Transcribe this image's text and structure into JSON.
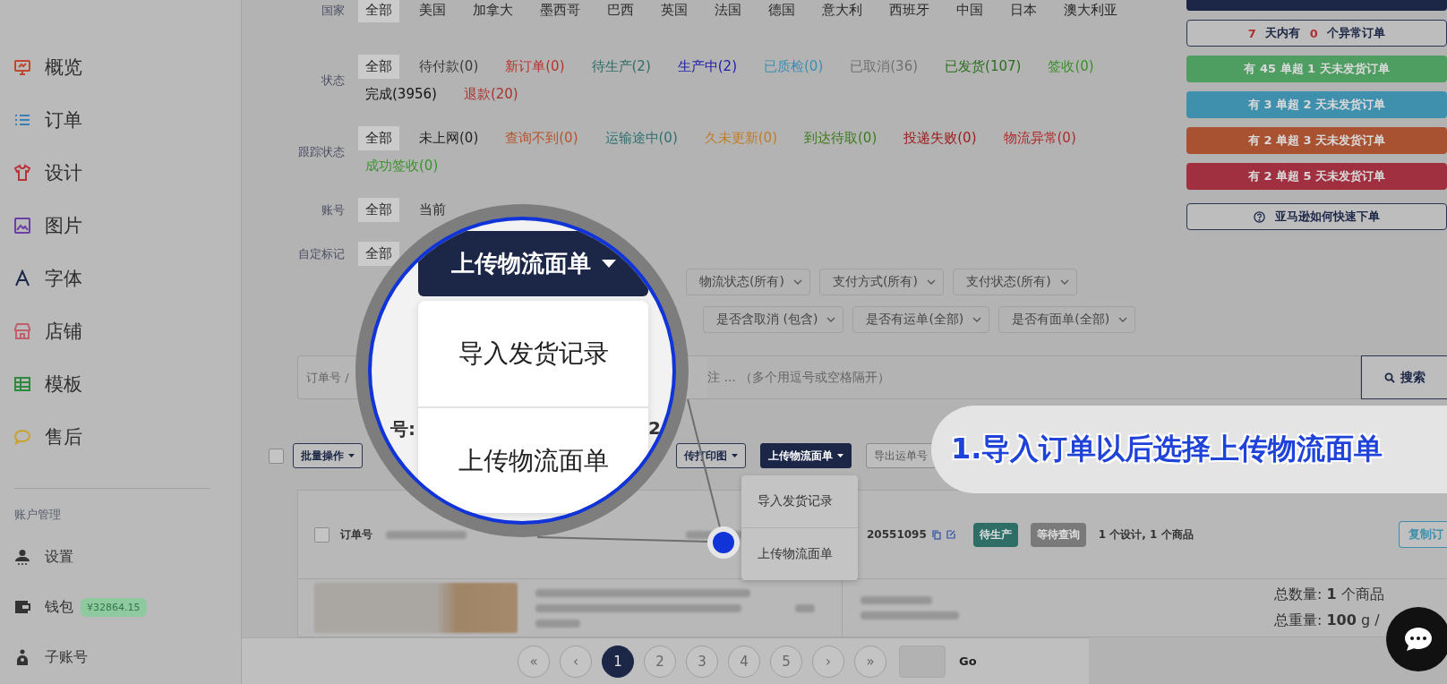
{
  "sidebar": {
    "nav": [
      {
        "label": "概览",
        "color": "#c2452d"
      },
      {
        "label": "订单",
        "color": "#3a7fb8"
      },
      {
        "label": "设计",
        "color": "#b8343a"
      },
      {
        "label": "图片",
        "color": "#6a3fa8"
      },
      {
        "label": "字体",
        "color": "#1c2747"
      },
      {
        "label": "店铺",
        "color": "#c0606a"
      },
      {
        "label": "模板",
        "color": "#2f8a3e"
      },
      {
        "label": "售后",
        "color": "#c9a22a"
      }
    ],
    "section_title": "账户管理",
    "account": [
      {
        "label": "设置"
      },
      {
        "label": "钱包",
        "badge": "¥32864.15"
      },
      {
        "label": "子账号"
      }
    ]
  },
  "filters": [
    {
      "label": "国家",
      "options": [
        {
          "text": "全部",
          "selected": true
        },
        {
          "text": "美国",
          "selected": false
        },
        {
          "text": "加拿大",
          "selected": false
        },
        {
          "text": "墨西哥",
          "selected": false
        },
        {
          "text": "巴西",
          "selected": false
        },
        {
          "text": "英国",
          "selected": false
        },
        {
          "text": "法国",
          "selected": false
        },
        {
          "text": "德国",
          "selected": false
        },
        {
          "text": "意大利",
          "selected": false
        },
        {
          "text": "西班牙",
          "selected": false
        },
        {
          "text": "中国",
          "selected": false
        },
        {
          "text": "日本",
          "selected": false
        },
        {
          "text": "澳大利亚",
          "selected": false
        }
      ]
    },
    {
      "label": "状态",
      "options": [
        {
          "text": "全部",
          "selected": true,
          "color": "#1e1e1e"
        },
        {
          "text": "待付款(0)",
          "selected": false,
          "color": "#3a3a3a"
        },
        {
          "text": "新订单(0)",
          "selected": false,
          "color": "#b8332c"
        },
        {
          "text": "待生产(2)",
          "selected": false,
          "color": "#2e6e66"
        },
        {
          "text": "生产中(2)",
          "selected": false,
          "color": "#1a1aa8"
        },
        {
          "text": "已质检(0)",
          "selected": false,
          "color": "#3b8fb0"
        },
        {
          "text": "已取消(36)",
          "selected": false,
          "color": "#707070"
        },
        {
          "text": "已发货(107)",
          "selected": false,
          "color": "#2b6e1e"
        },
        {
          "text": "签收(0)",
          "selected": false,
          "color": "#3a8f28"
        },
        {
          "text": "完成(3956)",
          "selected": false,
          "color": "#111111"
        },
        {
          "text": "退款(20)",
          "selected": false,
          "color": "#a8322c"
        }
      ]
    },
    {
      "label": "跟踪状态",
      "options": [
        {
          "text": "全部",
          "selected": true,
          "color": "#1e1e1e"
        },
        {
          "text": "未上网(0)",
          "selected": false,
          "color": "#222222"
        },
        {
          "text": "查询不到(0)",
          "selected": false,
          "color": "#b5532a"
        },
        {
          "text": "运输途中(0)",
          "selected": false,
          "color": "#2e7070"
        },
        {
          "text": "久未更新(0)",
          "selected": false,
          "color": "#c07d2a"
        },
        {
          "text": "到达待取(0)",
          "selected": false,
          "color": "#3d7a1e"
        },
        {
          "text": "投递失败(0)",
          "selected": false,
          "color": "#9c1c1c"
        },
        {
          "text": "物流异常(0)",
          "selected": false,
          "color": "#b02a2a"
        },
        {
          "text": "成功签收(0)",
          "selected": false,
          "color": "#3a9428"
        }
      ]
    },
    {
      "label": "账号",
      "options": [
        {
          "text": "全部",
          "selected": true
        },
        {
          "text": "当前",
          "selected": false
        }
      ]
    },
    {
      "label": "自定标记",
      "options": [
        {
          "text": "全部",
          "selected": true
        }
      ]
    }
  ],
  "alerts": [
    {
      "kind": "outline",
      "parts": [
        {
          "text": "7",
          "highlight": true
        },
        {
          "text": " 天内有 ",
          "highlight": false
        },
        {
          "text": "0",
          "highlight": true
        },
        {
          "text": " 个异常订单",
          "highlight": false
        }
      ]
    },
    {
      "kind": "filled",
      "text": "有 45 单超 1 天未发货订单",
      "color": "#4e9e62"
    },
    {
      "kind": "filled",
      "text": "有 3 单超 2 天未发货订单",
      "color": "#3f90ad"
    },
    {
      "kind": "filled",
      "text": "有 2 单超 3 天未发货订单",
      "color": "#a85232"
    },
    {
      "kind": "filled",
      "text": "有 2 单超 5 天未发货订单",
      "color": "#a03040"
    },
    {
      "kind": "help",
      "text": "亚马逊如何快速下单"
    }
  ],
  "filter_selects": [
    {
      "items": [
        "物流状态(所有)",
        "支付方式(所有)",
        "支付状态(所有)"
      ]
    },
    {
      "items": [
        "是否含取消 (包含)",
        "是否有运单(全部)",
        "是否有面单(全部)"
      ]
    }
  ],
  "search": {
    "placeholder": "订单号 /",
    "hint_tail": "注 ... （多个用逗号或空格隔开）",
    "button": "搜索"
  },
  "toolbar_checkbox": {
    "checked": false
  },
  "toolbar": [
    {
      "label": "批量操作",
      "kind": "outline"
    },
    {
      "label": "传打印图",
      "kind": "outline"
    },
    {
      "label": "上传物流面单",
      "kind": "dark"
    },
    {
      "label": "导出运单号",
      "kind": "plain"
    }
  ],
  "dropdown": {
    "items": [
      "导入发货记录",
      "上传物流面单"
    ]
  },
  "order": {
    "checked": false,
    "number_label": "订单号",
    "number": "20551095",
    "badges": [
      {
        "text": "待生产",
        "color": "#2e6e66"
      },
      {
        "text": "等待查询",
        "color": "#7a7a7a"
      }
    ],
    "summary": "1 个设计, 1 个商品",
    "copy_button": "复制订"
  },
  "product": {
    "totals": [
      "总数量: **1** 个商品",
      "总重量: **100** g /"
    ]
  },
  "pagination": {
    "pages": [
      {
        "text": "«",
        "selected": false
      },
      {
        "text": "‹",
        "selected": false
      },
      {
        "text": "1",
        "selected": true
      },
      {
        "text": "2",
        "selected": false
      },
      {
        "text": "3",
        "selected": false
      },
      {
        "text": "4",
        "selected": false
      },
      {
        "text": "5",
        "selected": false
      },
      {
        "text": "›",
        "selected": false
      },
      {
        "text": "»",
        "selected": false
      }
    ],
    "go": "Go"
  },
  "magnifier": {
    "button": "上传物流面单",
    "menu": [
      "导入发货记录",
      "上传物流面单"
    ],
    "fragments": [
      "号:",
      "2"
    ]
  },
  "callout": "1.导入订单以后选择上传物流面单"
}
